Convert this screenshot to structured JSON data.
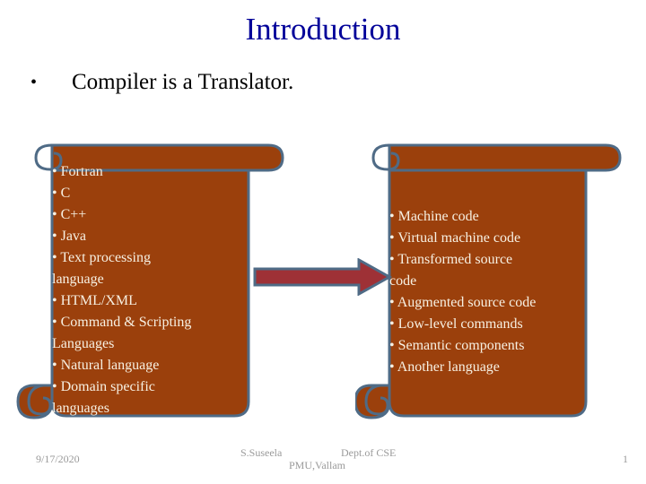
{
  "slide": {
    "title": "Introduction",
    "main_bullet": {
      "marker": "•",
      "text": "Compiler is a Translator."
    }
  },
  "scroll_left": {
    "name": "source-languages-scroll",
    "fill_color": "#9B400C",
    "outline_color": "#4F6B86",
    "text_color": "#F7F0E2",
    "items": [
      "• Fortran",
      "• C",
      "• C++",
      "• Java",
      "• Text processing",
      "language",
      "• HTML/XML",
      "• Command & Scripting",
      "   Languages",
      "• Natural language",
      "• Domain specific",
      "languages"
    ],
    "body_text": "• Fortran\n• C\n• C++\n• Java\n• Text processing\nlanguage\n• HTML/XML\n• Command & Scripting\n   Languages\n• Natural language\n• Domain specific\nlanguages"
  },
  "scroll_right": {
    "name": "target-outputs-scroll",
    "fill_color": "#9B400C",
    "outline_color": "#4F6B86",
    "text_color": "#F7F0E2",
    "items": [
      "• Machine code",
      "• Virtual machine code",
      "• Transformed source",
      "code",
      "• Augmented source code",
      "• Low-level commands",
      "• Semantic components",
      "• Another language"
    ],
    "body_text": "• Machine code\n• Virtual machine code\n• Transformed source\ncode\n• Augmented source code\n• Low-level commands\n• Semantic components\n• Another language"
  },
  "arrow": {
    "name": "translation-arrow",
    "direction": "right",
    "fill_color": "#9E3136",
    "outline_color": "#4F6B86"
  },
  "footer": {
    "date": "9/17/2020",
    "author": "S.Suseela",
    "department": "Dept.of CSE",
    "organization": "PMU,Vallam",
    "page_number": "1",
    "text_color": "#9a9a9a"
  },
  "theme": {
    "title_color": "#000099",
    "body_color": "#000000",
    "background": "#ffffff"
  }
}
